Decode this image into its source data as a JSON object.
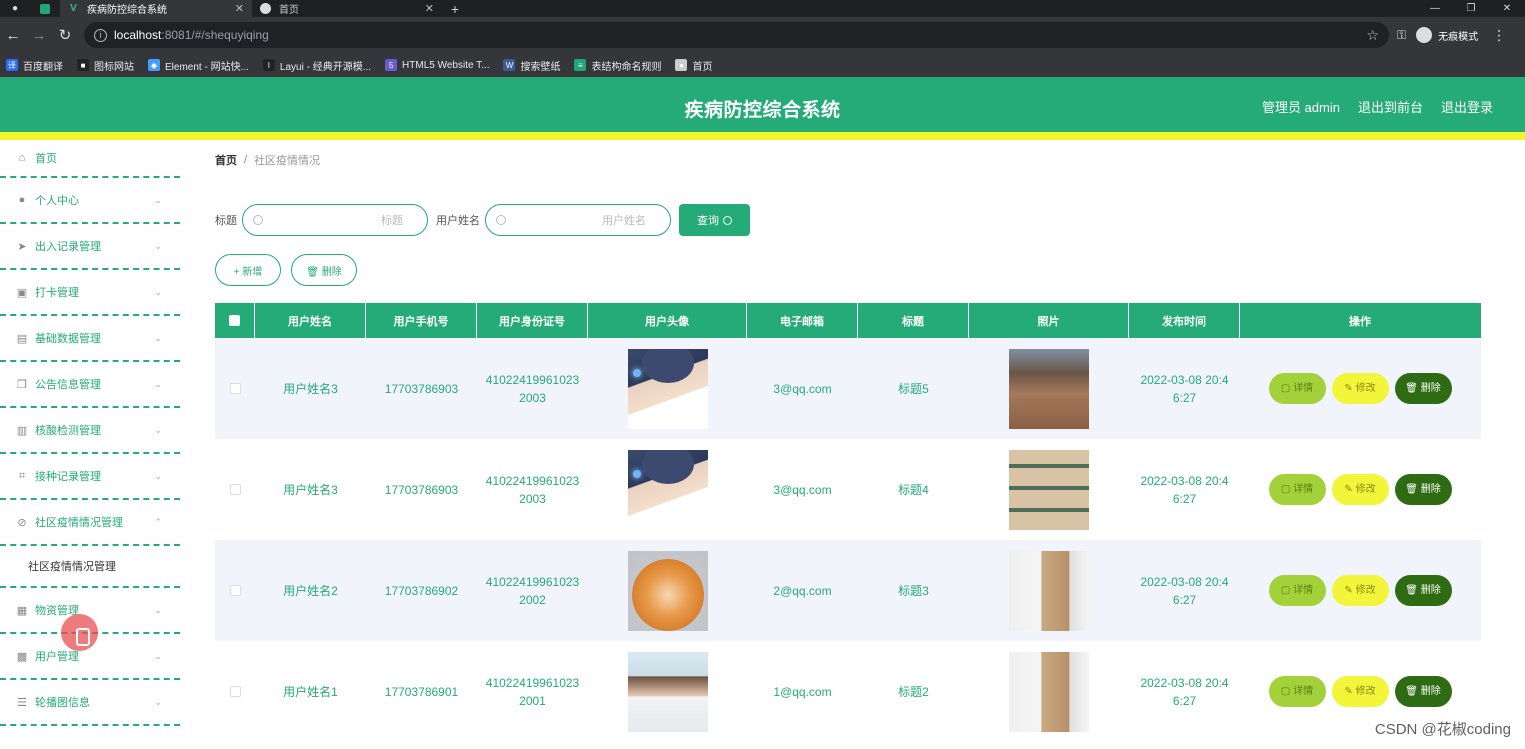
{
  "browser": {
    "tabs": [
      {
        "title": "疾病防控综合系统",
        "active": true
      },
      {
        "title": "首页",
        "active": false
      }
    ],
    "url_host": "localhost",
    "url_path": ":8081/#/shequyiqing",
    "profile_label": "无痕模式",
    "bookmarks": [
      {
        "label": "百度翻译",
        "color": "#2a6df4",
        "icon": "译"
      },
      {
        "label": "图标网站",
        "color": "#222222",
        "icon": "■"
      },
      {
        "label": "Element - 网站快...",
        "color": "#409eff",
        "icon": "◆"
      },
      {
        "label": "Layui - 经典开源模...",
        "color": "#222222",
        "icon": "l"
      },
      {
        "label": "HTML5 Website T...",
        "color": "#6a5acd",
        "icon": "5"
      },
      {
        "label": "搜索壁纸",
        "color": "#3a5a9a",
        "icon": "W"
      },
      {
        "label": "表结构命名规则",
        "color": "#21a675",
        "icon": "≡"
      },
      {
        "label": "首页",
        "color": "#cccccc",
        "icon": "●"
      }
    ]
  },
  "header": {
    "title": "疾病防控综合系统",
    "admin_label": "管理员 admin",
    "back_label": "退出到前台",
    "logout_label": "退出登录"
  },
  "sidebar": {
    "items": [
      {
        "label": "首页",
        "icon": "home-icon",
        "glyph": "⌂",
        "chevron": ""
      },
      {
        "label": "个人中心",
        "icon": "user-icon",
        "glyph": "●",
        "chevron": "⌄"
      },
      {
        "label": "出入记录管理",
        "icon": "send-icon",
        "glyph": "➤",
        "chevron": "⌄"
      },
      {
        "label": "打卡管理",
        "icon": "briefcase-icon",
        "glyph": "▣",
        "chevron": "⌄"
      },
      {
        "label": "基础数据管理",
        "icon": "clipboard-icon",
        "glyph": "▤",
        "chevron": "⌄"
      },
      {
        "label": "公告信息管理",
        "icon": "copy-icon",
        "glyph": "❐",
        "chevron": "⌄"
      },
      {
        "label": "核酸检测管理",
        "icon": "chart-icon",
        "glyph": "▥",
        "chevron": "⌄"
      },
      {
        "label": "接种记录管理",
        "icon": "crop-icon",
        "glyph": "⌗",
        "chevron": "⌄"
      },
      {
        "label": "社区疫情情况管理",
        "icon": "disabled-icon",
        "glyph": "⊘",
        "chevron": "⌃"
      }
    ],
    "submenu_label": "社区疫情情况管理",
    "items_after": [
      {
        "label": "物资管理",
        "icon": "box-icon",
        "glyph": "▦",
        "chevron": "⌄"
      },
      {
        "label": "用户管理",
        "icon": "user-card-icon",
        "glyph": "▩",
        "chevron": "⌄"
      },
      {
        "label": "轮播图信息",
        "icon": "sliders-icon",
        "glyph": "☰",
        "chevron": "⌄"
      }
    ]
  },
  "breadcrumb": {
    "home": "首页",
    "separator": "/",
    "current": "社区疫情情况"
  },
  "search": {
    "title_label": "标题",
    "title_placeholder": "标题",
    "username_label": "用户姓名",
    "username_placeholder": "用户姓名",
    "query_label": "查询"
  },
  "actions": {
    "add_label": "+ 新增",
    "delete_label": "🗑 删除"
  },
  "table": {
    "columns": [
      "",
      "用户姓名",
      "用户手机号",
      "用户身份证号",
      "用户头像",
      "电子邮箱",
      "标题",
      "照片",
      "发布时间",
      "操作"
    ],
    "rows": [
      {
        "name": "用户姓名3",
        "phone": "17703786903",
        "idcard": "41022419961023\n2003",
        "avatar": "avatar-boy",
        "email": "3@qq.com",
        "title": "标题5",
        "photo": "photo-boxes",
        "time": "2022-03-08 20:4\n6:27"
      },
      {
        "name": "用户姓名3",
        "phone": "17703786903",
        "idcard": "41022419961023\n2003",
        "avatar": "avatar-boy",
        "email": "3@qq.com",
        "title": "标题4",
        "photo": "photo-stack",
        "time": "2022-03-08 20:4\n6:27"
      },
      {
        "name": "用户姓名2",
        "phone": "17703786902",
        "idcard": "41022419961023\n2002",
        "avatar": "avatar-dog",
        "email": "2@qq.com",
        "title": "标题3",
        "photo": "photo-worker",
        "time": "2022-03-08 20:4\n6:27"
      },
      {
        "name": "用户姓名1",
        "phone": "17703786901",
        "idcard": "41022419961023\n2001",
        "avatar": "avatar-girl",
        "email": "1@qq.com",
        "title": "标题2",
        "photo": "photo-worker",
        "time": "2022-03-08 20:4\n6:27"
      }
    ],
    "ops": {
      "detail": "详情",
      "edit": "修改",
      "delete": "删除"
    }
  },
  "watermark": "CSDN @花椒coding",
  "colors": {
    "primary": "#24ab77",
    "accent_bar": "#f1f52c"
  }
}
